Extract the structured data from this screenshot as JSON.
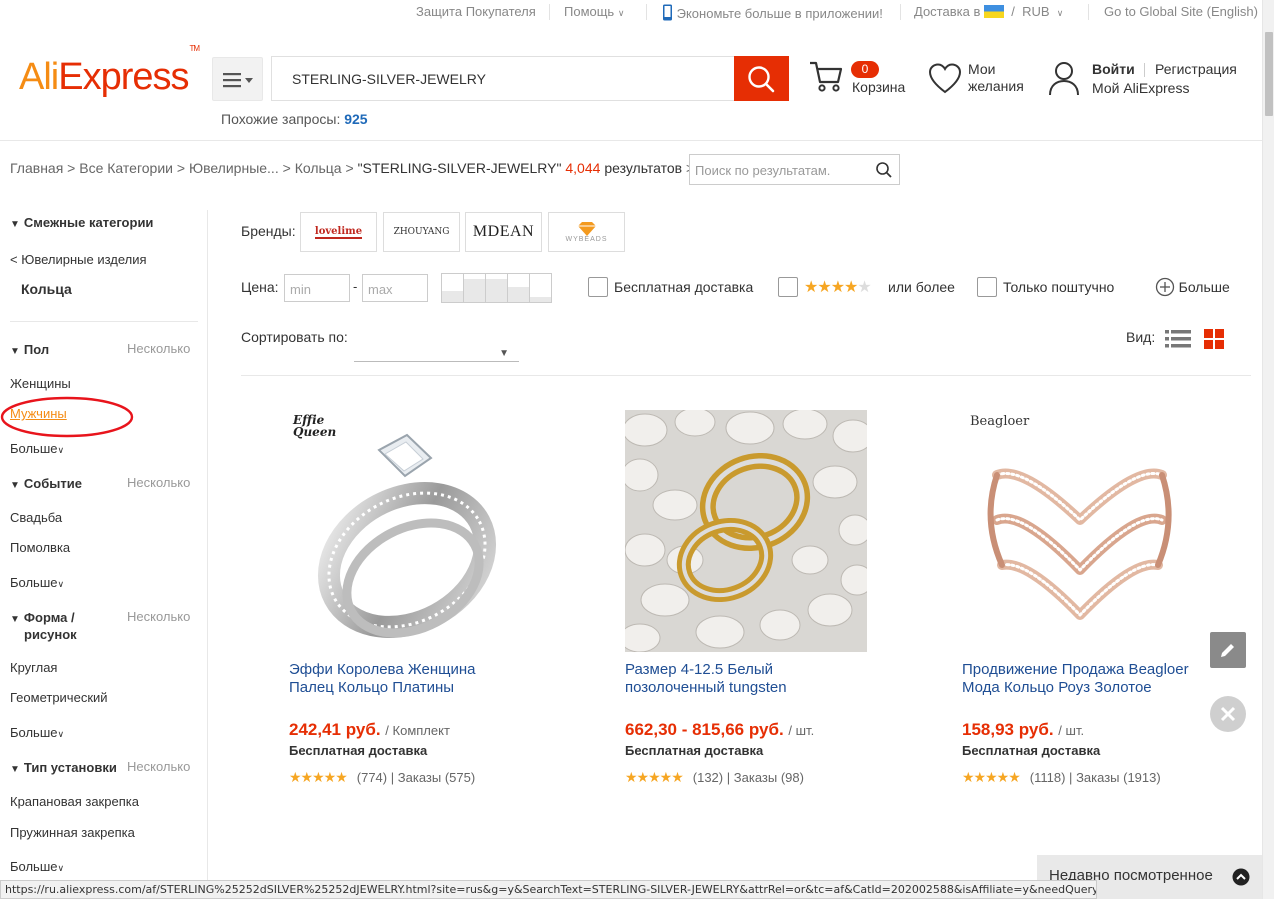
{
  "topbar": {
    "buyer_protection": "Защита Покупателя",
    "help": "Помощь",
    "app_promo": "Экономьте больше в приложении!",
    "delivery_to": "Доставка в",
    "currency_sep": "/",
    "currency": "RUB",
    "global_site": "Go to Global Site (English)"
  },
  "header": {
    "logo_part1": "Ali",
    "logo_part2": "Express",
    "logo_tm": "TM",
    "search_value": "STERLING-SILVER-JEWELRY",
    "similar_label": "Похожие запросы:",
    "similar_count": "925",
    "cart_count": "0",
    "cart_label": "Корзина",
    "wishlist_line1": "Мои",
    "wishlist_line2": "желания",
    "login": "Войти",
    "register": "Регистрация",
    "my_account": "Мой AliExpress"
  },
  "breadcrumb": {
    "home": "Главная",
    "all_categories": "Все Категории",
    "jewelry": "Ювелирные...",
    "rings": "Кольца",
    "query": "\"STERLING-SILVER-JEWELRY\"",
    "result_count": "4,044",
    "results_word": "результатов",
    "search_placeholder": "Поиск по результатам."
  },
  "sidebar": {
    "related_title": "Смежные категории",
    "parent_category": "< Ювелирные изделия",
    "current_category": "Кольца",
    "multi_label": "Несколько",
    "more_label": "Больше",
    "groups": [
      {
        "title": "Пол",
        "items": [
          "Женщины",
          "Мужчины"
        ]
      },
      {
        "title": "Событие",
        "items": [
          "Свадьба",
          "Помолвка"
        ]
      },
      {
        "title_line1": "Форма /",
        "title_line2": "рисунок",
        "items": [
          "Круглая",
          "Геометрический"
        ]
      },
      {
        "title": "Тип установки",
        "items": [
          "Крапановая закрепка",
          "Пружинная закрепка"
        ]
      }
    ]
  },
  "filters": {
    "brands_label": "Бренды:",
    "brands": [
      "lovelime",
      "ZHOUYANG",
      "MDEAN",
      "WYBEADS"
    ],
    "price_label": "Цена:",
    "price_min_placeholder": "min",
    "price_dash": "-",
    "price_max_placeholder": "max",
    "free_shipping": "Бесплатная доставка",
    "rating_suffix": "или более",
    "single_only": "Только поштучно",
    "more": "Больше",
    "sort_label": "Сортировать по:",
    "view_label": "Вид:"
  },
  "products": [
    {
      "title_line1": "Эффи Королева Женщина",
      "title_line2": "Палец Кольцо Платины",
      "price": "242,41 руб.",
      "unit": "/ Комплект",
      "shipping": "Бесплатная доставка",
      "stars": "★★★★★",
      "reviews": "(774)",
      "orders": "Заказы (575)",
      "brand_mark_line1": "Effie",
      "brand_mark_line2": "Queen"
    },
    {
      "title_line1": "Размер 4-12.5 Белый",
      "title_line2": "позолоченный tungsten",
      "price": "662,30 - 815,66 руб.",
      "unit": "/ шт.",
      "shipping": "Бесплатная доставка",
      "stars": "★★★★★",
      "reviews": "(132)",
      "orders": "Заказы (98)"
    },
    {
      "title_line1": "Продвижение Продажа Beagloer",
      "title_line2": "Мода Кольцо Роуз Золотое",
      "price": "158,93 руб.",
      "unit": "/ шт.",
      "shipping": "Бесплатная доставка",
      "stars": "★★★★★",
      "reviews": "(1118)",
      "orders": "Заказы (1913)",
      "brand_mark": "Beagloer"
    }
  ],
  "rating_sep": "|",
  "recently_viewed": "Недавно посмотренное",
  "status_url": "https://ru.aliexpress.com/af/STERLING%25252dSILVER%25252dJEWELRY.html?site=rus&g=y&SearchText=STERLING-SILVER-JEWELRY&attrRel=or&tc=af&CatId=202002588&isAffiliate=y&needQuery=n&pvId=284-100006038",
  "colors": {
    "brand_red": "#e62e04",
    "brand_orange": "#f58c14",
    "link_blue": "#1f6ab9",
    "annotation_red": "#e8141c"
  }
}
